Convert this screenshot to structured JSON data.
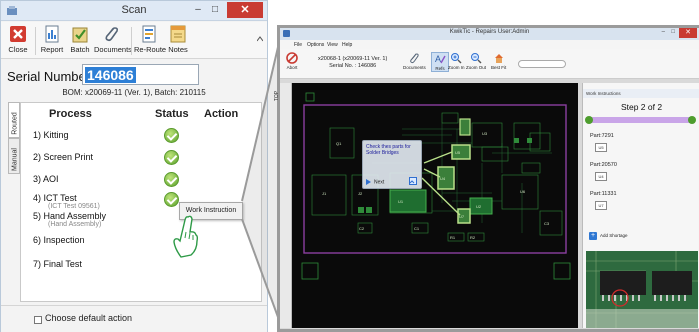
{
  "scan_window": {
    "title": "Scan",
    "controls": {
      "minimize": "–",
      "maximize": "□",
      "close": "✕"
    },
    "toolbar": [
      {
        "label": "Close",
        "icon": "close-icon"
      },
      {
        "label": "Report",
        "icon": "report-icon"
      },
      {
        "label": "Batch",
        "icon": "batch-icon"
      },
      {
        "label": "Documents",
        "icon": "paperclip-icon"
      },
      {
        "label": "Re-Route",
        "icon": "reroute-icon"
      },
      {
        "label": "Notes",
        "icon": "notes-icon"
      }
    ],
    "serial_label": "Serial Number:",
    "serial_value": "146086",
    "bom_line": "BOM: x20069-11 (Ver. 1), Batch: 210115",
    "side_tabs": [
      "Routed",
      "Manual"
    ],
    "columns": {
      "process": "Process",
      "status": "Status",
      "action": "Action"
    },
    "steps": [
      {
        "label": "1)  Kitting",
        "status": "done"
      },
      {
        "label": "2)  Screen Print",
        "status": "done"
      },
      {
        "label": "3)  AOI",
        "status": "done"
      },
      {
        "label": "4)  ICT Test",
        "sub": "(ICT Test 09561)",
        "status": "done"
      },
      {
        "label": "5)  Hand Assembly",
        "sub": "(Hand Assembly)",
        "status": ""
      },
      {
        "label": "6)  Inspection",
        "status": ""
      },
      {
        "label": "7)  Final Test",
        "status": ""
      }
    ],
    "context_button": "Work Instruction",
    "default_action_label": "Choose default action",
    "colors": {
      "check": "#5aa02c",
      "close": "#c93b33",
      "selection": "#2d7fd6"
    }
  },
  "kwiktic_window": {
    "title": "KwikTic - Repairs User:Admin",
    "menu": [
      "File",
      "Options",
      "View",
      "Help"
    ],
    "abort_label": "Abort",
    "serial_line1": "x20068-1 (x20069-11 Ver. 1)",
    "serial_line2": "Serial No. : 146086",
    "toolbar": [
      {
        "label": "Documents",
        "icon": "paperclip-icon"
      },
      {
        "label": "Refs",
        "icon": "refs-icon"
      },
      {
        "label": "Zoom In",
        "icon": "zoom-in-icon"
      },
      {
        "label": "Zoom Out",
        "icon": "zoom-out-icon"
      },
      {
        "label": "Best Fit",
        "icon": "best-fit-icon"
      }
    ],
    "side_tab": "TOP",
    "popup": {
      "message": "Check thes parts for Solder Bridges",
      "next_label": "Next"
    },
    "work_instructions": {
      "header": "Work Instructions",
      "step": "Step 2 of 2",
      "parts": [
        {
          "label": "Part:7291",
          "ref": "U5"
        },
        {
          "label": "Part:20570",
          "ref": "U4"
        },
        {
          "label": "Part:11331",
          "ref": "U7"
        }
      ],
      "add_shortage": "Add Shortage"
    },
    "pcb_labels": [
      "U1",
      "U2",
      "U3",
      "U4",
      "U5",
      "U6",
      "U7",
      "J1",
      "J2",
      "R1",
      "R2",
      "C1",
      "C2",
      "C3",
      "Q1"
    ]
  }
}
